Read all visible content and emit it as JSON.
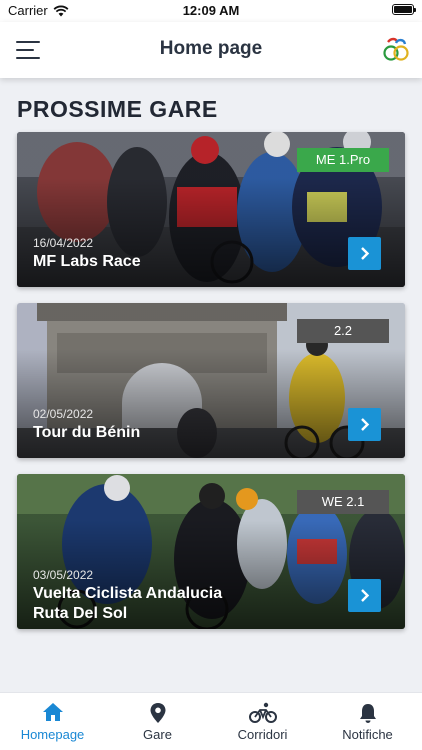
{
  "status_bar": {
    "carrier": "Carrier",
    "time": "12:09 AM"
  },
  "nav": {
    "title": "Home page",
    "menu_icon": "hamburger-menu-icon",
    "logo_icon": "cycling-brand-logo"
  },
  "section": {
    "title": "PROSSIME GARE"
  },
  "races": [
    {
      "category": "ME 1.Pro",
      "category_color": "#3aa84b",
      "date": "16/04/2022",
      "name_lines": [
        "MF Labs Race"
      ]
    },
    {
      "category": "2.2",
      "category_color": "#555555",
      "date": "02/05/2022",
      "name_lines": [
        "Tour du Bénin"
      ]
    },
    {
      "category": "WE 2.1",
      "category_color": "#555555",
      "date": "03/05/2022",
      "name_lines": [
        "Vuelta Ciclista Andalucia",
        "Ruta Del Sol"
      ]
    }
  ],
  "tabs": [
    {
      "label": "Homepage",
      "icon": "home-icon",
      "active": true
    },
    {
      "label": "Gare",
      "icon": "map-pin-icon",
      "active": false
    },
    {
      "label": "Corridori",
      "icon": "bicycle-icon",
      "active": false
    },
    {
      "label": "Notifiche",
      "icon": "bell-icon",
      "active": false
    }
  ],
  "colors": {
    "accent": "#1a93d6",
    "active_tab": "#1a88d4"
  }
}
